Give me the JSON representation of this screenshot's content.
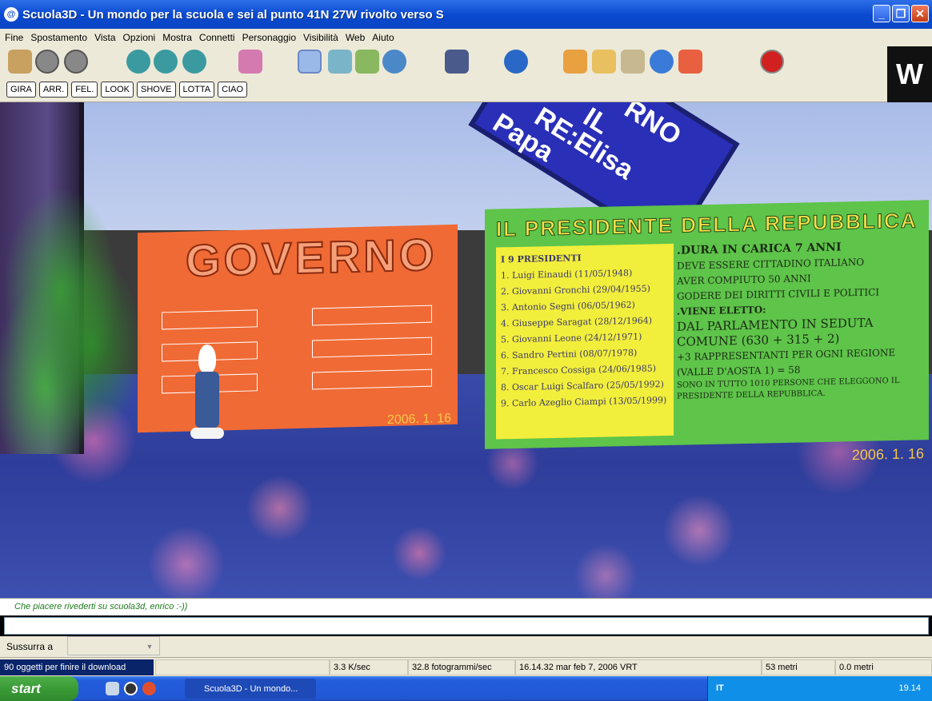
{
  "window": {
    "title": "Scuola3D - Un mondo per la scuola e sei al punto 41N 27W rivolto verso S",
    "app_icon": "3d-world-icon",
    "controls": [
      "minimize",
      "maximize",
      "close"
    ]
  },
  "menu": [
    "Fine",
    "Spostamento",
    "Vista",
    "Opzioni",
    "Mostra",
    "Connetti",
    "Personaggio",
    "Visibilità",
    "Web",
    "Aiuto"
  ],
  "toolbar": {
    "icons": [
      "home-icon",
      "back-icon",
      "forward-icon",
      "eye-icon",
      "eye2-icon",
      "eye3-icon",
      "avatar-icon",
      "person-icon",
      "pin-icon",
      "people-icon",
      "users-icon",
      "chat-icon",
      "browser-icon",
      "tools-icon",
      "mail-icon",
      "map-icon",
      "globe-icon",
      "help-icon",
      "stop-icon"
    ],
    "commands": [
      "GIRA",
      "ARR.",
      "FEL.",
      "LOOK",
      "SHOVE",
      "LOTTA",
      "CIAO"
    ],
    "logo": "W"
  },
  "scene": {
    "orange_poster": {
      "title": "GOVERNO",
      "date": "2006. 1. 16"
    },
    "green_poster": {
      "title": "IL PRESIDENTE DELLA REPUBBLICA",
      "list_title": "I 9 PRESIDENTI",
      "presidents": [
        "1. Luigi Einaudi (11/05/1948)",
        "2. Giovanni Gronchi (29/04/1955)",
        "3. Antonio Segni (06/05/1962)",
        "4. Giuseppe Saragat (28/12/1964)",
        "5. Giovanni Leone (24/12/1971)",
        "6. Sandro Pertini (08/07/1978)",
        "7. Francesco Cossiga (24/06/1985)",
        "8. Oscar Luigi Scalfaro (25/05/1992)",
        "9. Carlo Azeglio Ciampi (13/05/1999)"
      ],
      "info": [
        ".DURA IN CARICA 7 ANNI",
        "DEVE ESSERE CITTADINO ITALIANO",
        "AVER COMPIUTO 50 ANNI",
        "GODERE DEI DIRITTI CIVILI E POLITICI",
        ".VIENE ELETTO:",
        "DAL PARLAMENTO IN SEDUTA",
        "COMUNE (630 + 315 + 2)",
        "+3 RAPPRESENTANTI PER OGNI REGIONE",
        "(VALLE D'AOSTA 1) = 58",
        "SONO IN TUTTO 1010 PERSONE CHE ELEGGONO IL PRESIDENTE DELLA REPUBBLICA."
      ],
      "date": "2006. 1. 16"
    },
    "blue_sign": [
      "RNO",
      "IL",
      "RE:Elisa",
      "Papa"
    ]
  },
  "chat": {
    "message": "Che piacere rivederti su scuola3d, enrico :-))",
    "input_value": ""
  },
  "whisper": {
    "label": "Sussurra a",
    "selected": ""
  },
  "status": {
    "download": "90 oggetti per finire il download",
    "rate": "3.3 K/sec",
    "fps": "32.8 fotogrammi/sec",
    "datetime": "16.14.32 mar feb 7, 2006 VRT",
    "distance": "53 metri",
    "altitude": "0.0 metri"
  },
  "taskbar": {
    "start": "start",
    "task": "Scuola3D - Un mondo...",
    "lang": "IT",
    "clock": "19.14"
  }
}
